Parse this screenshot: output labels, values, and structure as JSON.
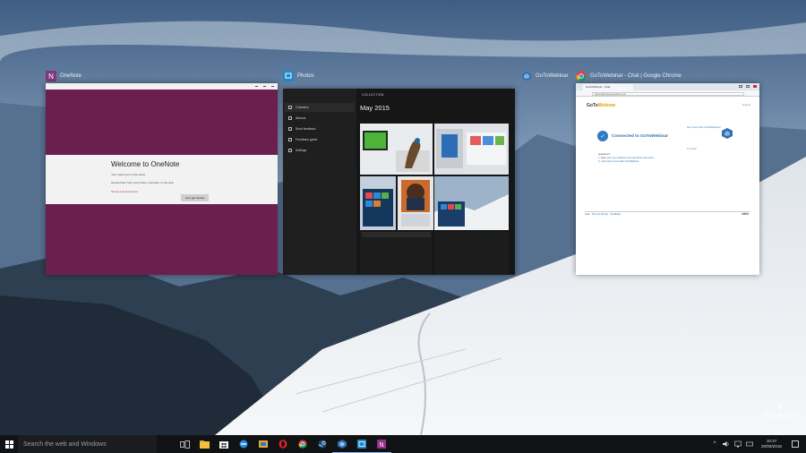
{
  "colors": {
    "onenote_purple": "#6b1f4f",
    "photos_dark": "#161616",
    "taskbar": "#101214",
    "accent_blue": "#2f7dc1"
  },
  "windows": [
    {
      "id": "onenote",
      "label": "OneNote",
      "icon": "onenote-icon"
    },
    {
      "id": "photos",
      "label": "Photos",
      "icon": "photos-icon"
    },
    {
      "id": "gotowebinar-title",
      "label": "GoToWebinar",
      "icon": "gotowebinar-icon"
    },
    {
      "id": "chrome",
      "label": "GoToWebinar - Chat | Google Chrome",
      "icon": "chrome-icon"
    }
  ],
  "onenote": {
    "heading": "Welcome to OneNote",
    "line1": "Your notes sync to the cloud.",
    "line2": "Access them from your phone, computer, or the web.",
    "link": "Set up a work account",
    "button": "Let's get started"
  },
  "photos": {
    "header": "COLLECTION",
    "month": "May 2015",
    "nav": [
      "Collection",
      "Albums",
      "Send feedback",
      "Feedback game",
      "Settings"
    ]
  },
  "chrome": {
    "tab": "GoToWebinar - Chat",
    "url": "https://global.gotowebinar.com",
    "logo_pre": "GoTo",
    "logo_post": "Webinar",
    "top_link": "Support",
    "connected": "Connected to GoToWebinar",
    "steps_title": "Questions?",
    "step1": "1. Make sure your webinar is set up before your event.",
    "step2": "2. Learn how to host with GoToWebinar.",
    "aside": "Get Your Own GoToWebinar",
    "aside_sub": "Try it free",
    "footer": "Help · Terms & Privacy · Feedback",
    "footer_logo": "citrix"
  },
  "new_desktop": {
    "label": "New desktop"
  },
  "taskbar": {
    "search_placeholder": "Search the web and Windows",
    "apps": [
      "task-view-icon",
      "file-explorer-icon",
      "store-icon",
      "edge-icon",
      "folder-icon",
      "opera-icon",
      "chrome-icon",
      "steam-icon",
      "gotowebinar-icon",
      "photos-icon",
      "onenote-icon"
    ],
    "time": "10:37",
    "date": "20/05/2015"
  }
}
